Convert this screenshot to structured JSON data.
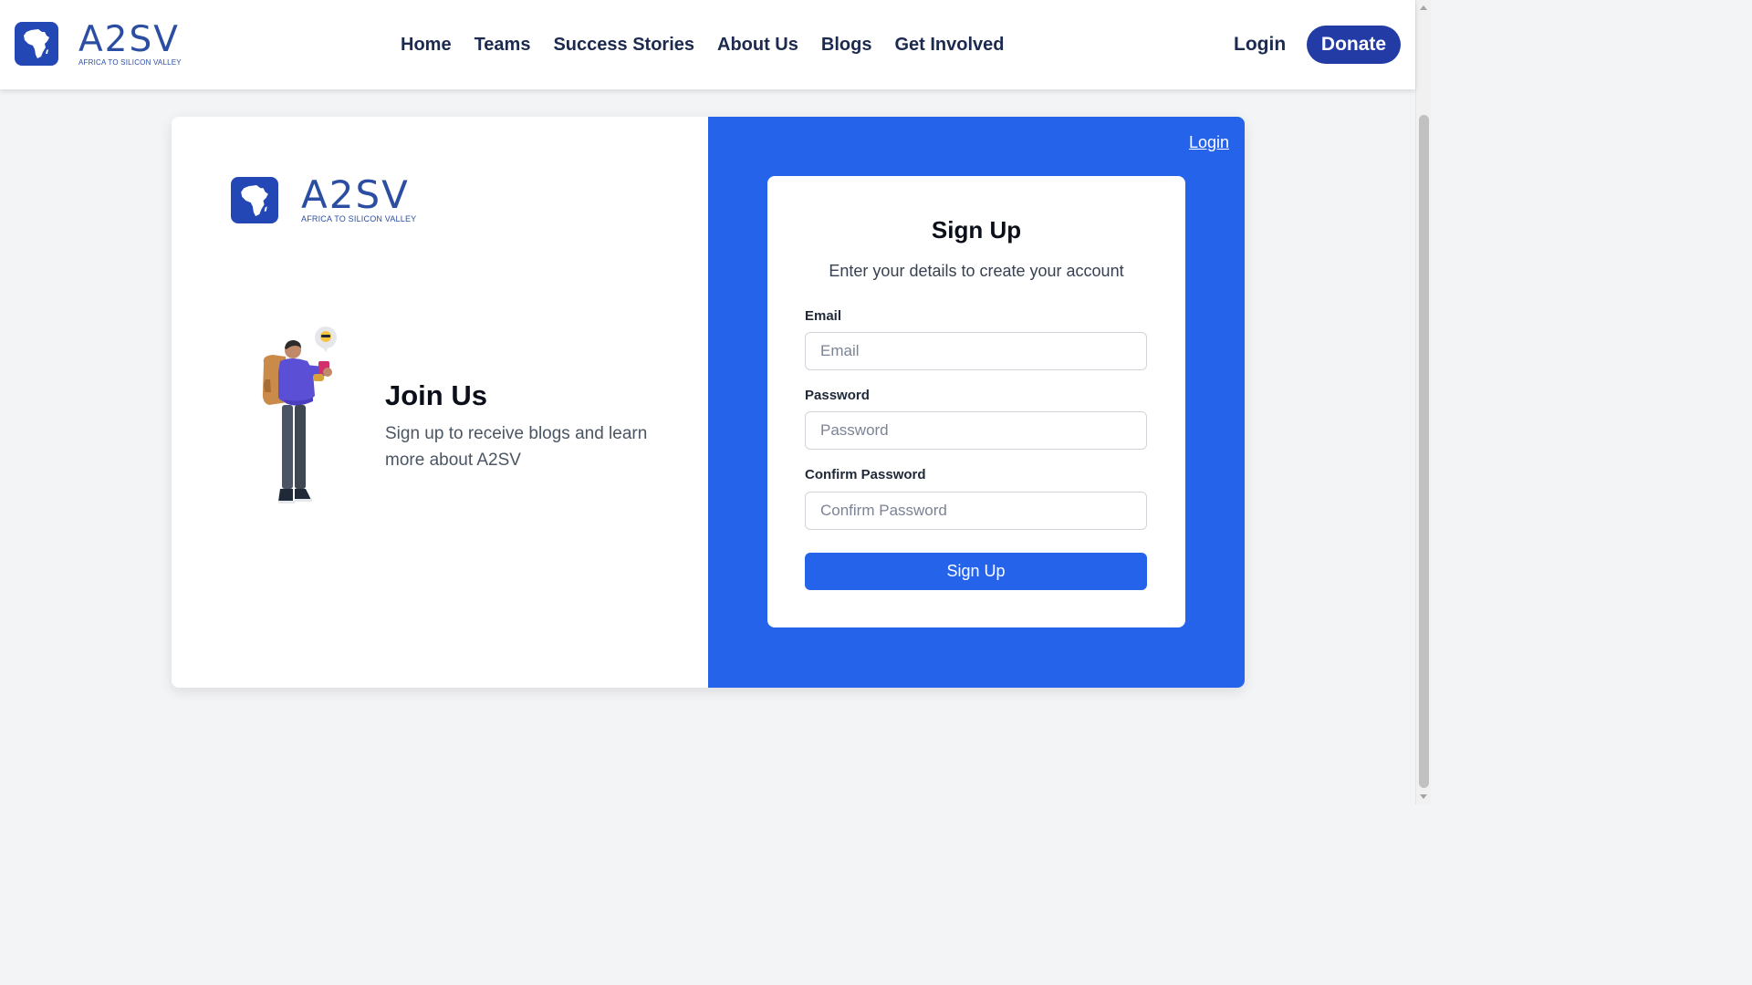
{
  "brand": {
    "wordmark": "A2SV",
    "tagline": "AFRICA TO SILICON VALLEY",
    "logo_icon": "africa-map-icon",
    "color": "#2b4ea2"
  },
  "nav": {
    "links": [
      "Home",
      "Teams",
      "Success Stories",
      "About Us",
      "Blogs",
      "Get Involved"
    ],
    "login": "Login",
    "donate": "Donate"
  },
  "join": {
    "title": "Join Us",
    "text": "Sign up to receive blogs and learn more about A2SV",
    "illustration": "person-with-backpack-using-phone"
  },
  "signup": {
    "login_link": "Login",
    "title": "Sign Up",
    "subtitle": "Enter your details to create your account",
    "email_label": "Email",
    "email_placeholder": "Email",
    "password_label": "Password",
    "password_placeholder": "Password",
    "confirm_label": "Confirm Password",
    "confirm_placeholder": "Confirm Password",
    "submit": "Sign Up"
  },
  "colors": {
    "primary": "#2563eb",
    "donate": "#223ba5",
    "background": "#f3f4f6"
  }
}
